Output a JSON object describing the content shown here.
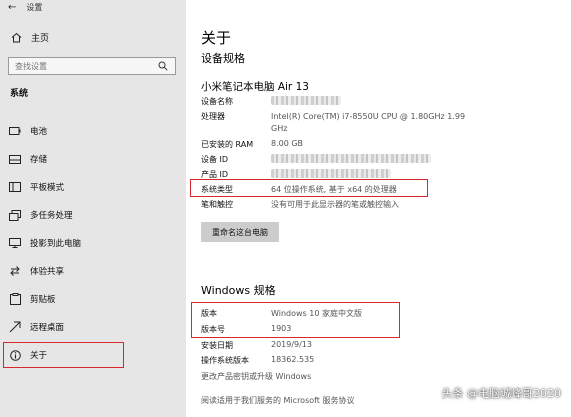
{
  "window": {
    "app_title": "设置"
  },
  "sidebar": {
    "home_label": "主页",
    "search_placeholder": "查找设置",
    "section_label": "系统",
    "items": [
      {
        "label": "电池",
        "icon": "battery-icon"
      },
      {
        "label": "存储",
        "icon": "storage-icon"
      },
      {
        "label": "平板模式",
        "icon": "tablet-mode-icon"
      },
      {
        "label": "多任务处理",
        "icon": "multitasking-icon"
      },
      {
        "label": "投影到此电脑",
        "icon": "project-icon"
      },
      {
        "label": "体验共享",
        "icon": "shared-experiences-icon"
      },
      {
        "label": "剪贴板",
        "icon": "clipboard-icon"
      },
      {
        "label": "远程桌面",
        "icon": "remote-desktop-icon"
      },
      {
        "label": "关于",
        "icon": "info-icon",
        "selected": true
      }
    ]
  },
  "main": {
    "title": "关于",
    "device_spec_heading": "设备规格",
    "device_name": "小米笔记本电脑 Air 13",
    "device_specs": [
      {
        "label": "设备名称",
        "value": ""
      },
      {
        "label": "处理器",
        "value": "Intel(R) Core(TM) i7-8550U CPU @ 1.80GHz   1.99 GHz"
      },
      {
        "label": "已安装的 RAM",
        "value": "8.00 GB"
      },
      {
        "label": "设备 ID",
        "value": ""
      },
      {
        "label": "产品 ID",
        "value": ""
      },
      {
        "label": "系统类型",
        "value": "64 位操作系统, 基于 x64 的处理器"
      },
      {
        "label": "笔和触控",
        "value": "没有可用于此显示器的笔或触控输入"
      }
    ],
    "rename_button": "重命名这台电脑",
    "windows_spec_heading": "Windows 规格",
    "windows_specs": [
      {
        "label": "版本",
        "value": "Windows 10 家庭中文版"
      },
      {
        "label": "版本号",
        "value": "1903"
      },
      {
        "label": "安装日期",
        "value": "2019/9/13"
      },
      {
        "label": "操作系统版本",
        "value": "18362.535"
      }
    ],
    "change_key_link": "更改产品密钥或升级 Windows",
    "agreement_link": "阅读适用于我们服务的 Microsoft 服务协议"
  },
  "watermark": "头条 @电脑城峰哥2020",
  "colors": {
    "highlight_border": "#d9282d",
    "sidebar_bg": "#e6e6e6"
  }
}
